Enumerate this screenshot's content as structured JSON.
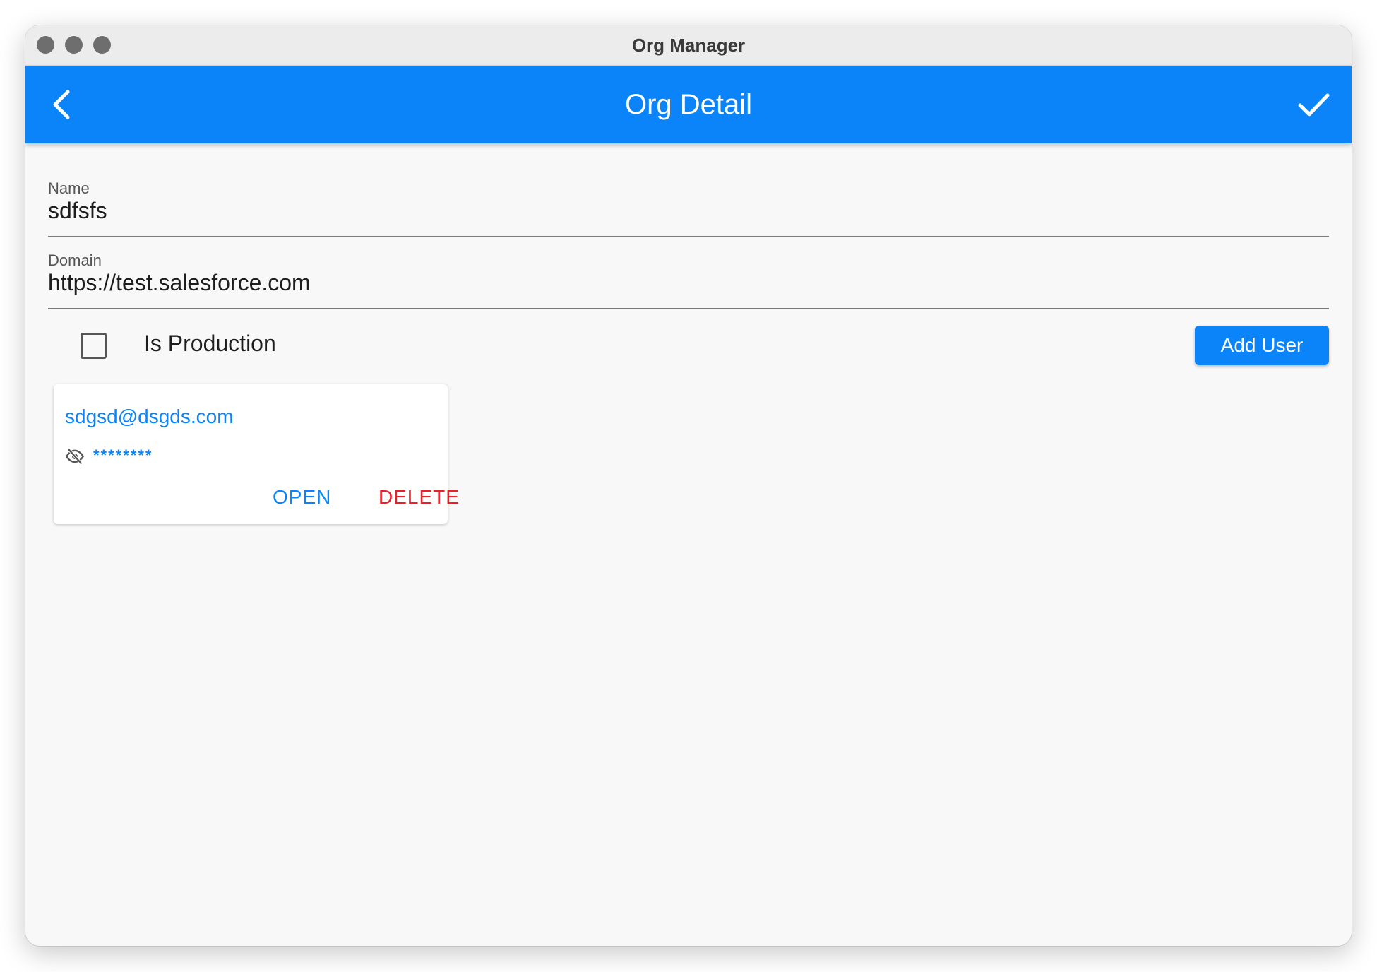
{
  "window": {
    "title": "Org Manager"
  },
  "appbar": {
    "title": "Org Detail",
    "back_icon": "chevron-left-icon",
    "confirm_icon": "checkmark-icon",
    "color": "#0b84f9"
  },
  "form": {
    "name": {
      "label": "Name",
      "value": "sdfsfs"
    },
    "domain": {
      "label": "Domain",
      "value": "https://test.salesforce.com"
    },
    "is_production": {
      "label": "Is Production",
      "checked": false
    },
    "add_user_label": "Add User"
  },
  "users": [
    {
      "email": "sdgsd@dsgds.com",
      "password_masked": "********",
      "visibility_icon": "eye-off-icon",
      "open_label": "OPEN",
      "delete_label": "DELETE"
    }
  ],
  "colors": {
    "accent": "#0b84f9",
    "danger": "#e8202a",
    "background": "#f8f8f8"
  }
}
